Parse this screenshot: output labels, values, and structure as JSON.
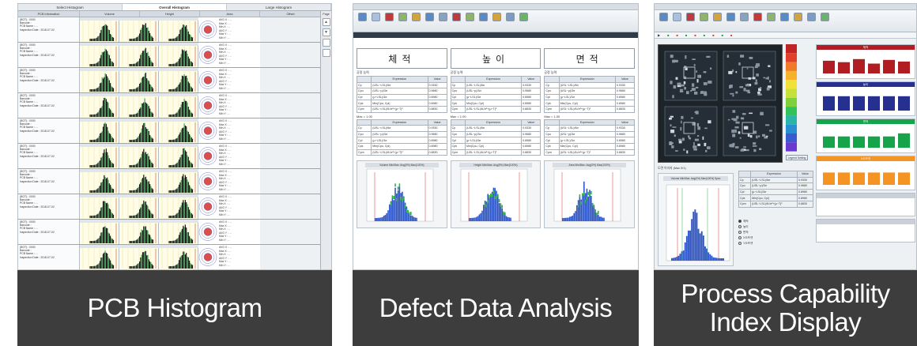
{
  "captions": {
    "p1": "PCB Histogram",
    "p2": "Defect Data Analysis",
    "p3_line1": "Process Capability",
    "p3_line2": "Index Display"
  },
  "colors": {
    "caption_bg": "#3d3d3d",
    "histogram_main": "#1a1a1a",
    "histogram_green": "#2fb14a",
    "histogram_blue": "#2f57c8",
    "limit_line": "#d0312d",
    "card_red": "#b01e23",
    "card_blue": "#25308f",
    "card_green": "#16a34a",
    "card_orange": "#f59323"
  },
  "p1": {
    "tabs": [
      "Select Histogram",
      "Overall Histogram",
      "Large Histogram"
    ],
    "columns": [
      "PCB Information",
      "Volume",
      "Height",
      "Area",
      "Offset"
    ],
    "info_lines": [
      "(BOT) : 0000",
      "Barcode :",
      "PCB Name : ...",
      "Inspection Date : 2018-07-02"
    ],
    "offset_lines": [
      "AVG X : ...",
      "Max X : ...",
      "Min X : ...",
      "AVG Y : ...",
      "Max Y : ...",
      "Min Y : ..."
    ],
    "side": {
      "label": "Page",
      "up": "▲",
      "down": "▼"
    }
  },
  "p2": {
    "titles": [
      "체적",
      "높이",
      "면적"
    ],
    "table_header": [
      "",
      "Expression",
      "Value"
    ],
    "table_rows": [
      [
        "Cp",
        "(USL−LSL)/6σ",
        "0.9330"
      ],
      [
        "Cpu",
        "(USL−μ)/3σ",
        "0.9680"
      ],
      [
        "Cpl",
        "(μ−LSL)/3σ",
        "0.8980"
      ],
      [
        "Cpk",
        "Min(Cpu, Cpl)",
        "0.8980"
      ],
      [
        "Cpm",
        "(USL−LSL)/6√σ²+(μ−T)²",
        "0.8830"
      ]
    ],
    "sub_a": "공정 능력",
    "sub_b": "Max = 1.00",
    "hist_titles": [
      "Volume Min/Max: Avg(0%) Max(100%)",
      "Height Min/Max: Avg(0%) Max(100%)",
      "Area Min/Max: Avg(0%) Max(100%)"
    ]
  },
  "p3": {
    "legend_btn": "Legend Setting",
    "lower_label": "도면 이미지 (Max 0/1)",
    "lower_hist_title": "Volume Min/Max: Avg(0%) Max(100%) Spec",
    "radios": [
      "체적",
      "높이",
      "면적",
      "X오프셋",
      "Y오프셋"
    ],
    "cards": [
      {
        "title": "체적",
        "values": [
          0.62,
          0.55,
          0.7,
          0.48,
          0.66,
          0.58
        ]
      },
      {
        "title": "높이",
        "values": [
          0.7,
          0.7,
          0.7,
          0.7,
          0.7,
          0.7
        ]
      },
      {
        "title": "면적",
        "values": [
          0.55,
          0.55,
          0.55,
          0.55,
          0.55,
          0.7
        ]
      },
      {
        "title": "X오프셋",
        "values": [
          0.6,
          0.6,
          0.6,
          0.6,
          0.6,
          0.6
        ]
      }
    ]
  }
}
